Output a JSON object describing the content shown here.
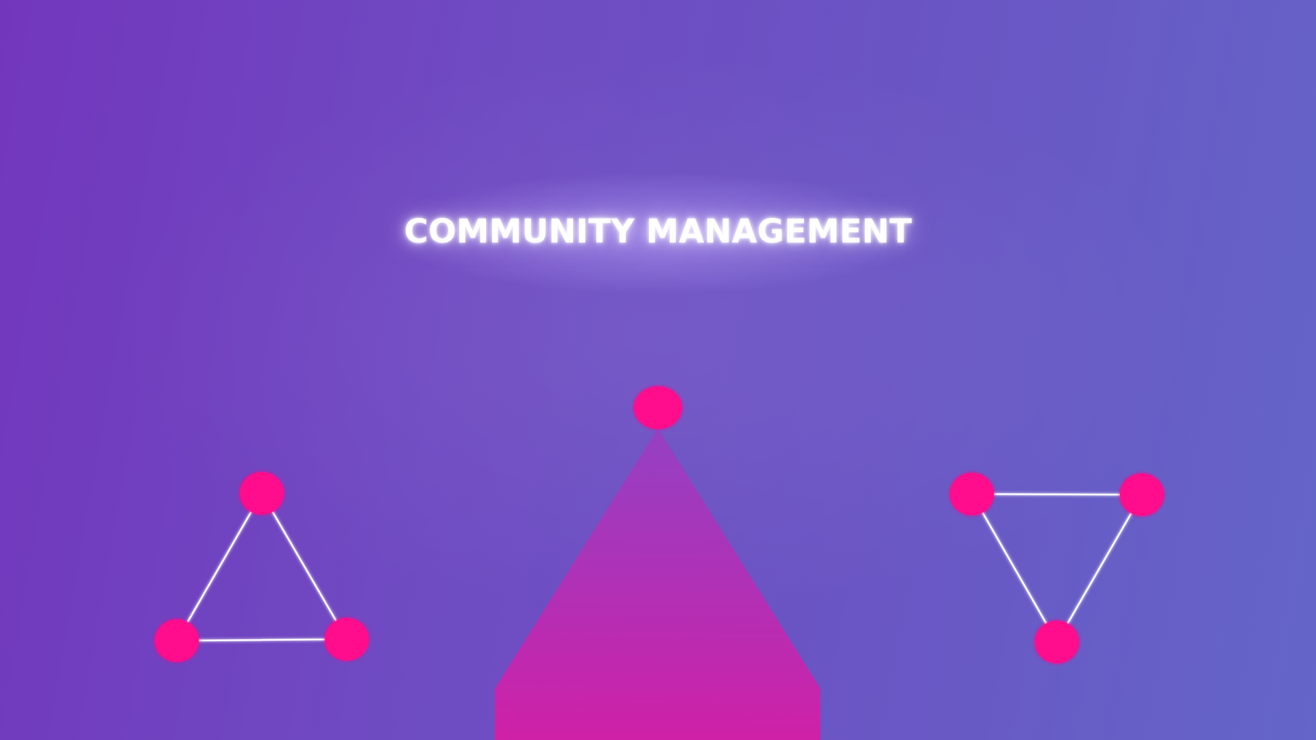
{
  "title": "COMMUNITY MANAGEMENT",
  "colors": {
    "background_left": "#7236bd",
    "background_right": "#6465c8",
    "node": "#ff0d8c",
    "edge": "#ffffff",
    "pyramid_top": "#9b3cc2",
    "pyramid_bottom": "#d41ea6"
  },
  "graphics": {
    "left_network": "triangle-network",
    "right_network": "inverted-triangle-network",
    "center_shape": "pyramid-with-apex-node"
  }
}
